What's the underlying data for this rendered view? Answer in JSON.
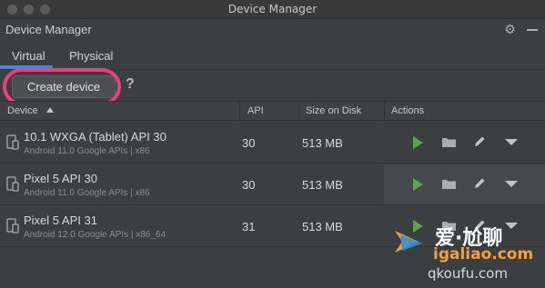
{
  "window": {
    "title": "Device Manager"
  },
  "toolwindow": {
    "title": "Device Manager",
    "settings_icon": "gear-icon",
    "minimize_icon": "minimize-icon"
  },
  "tabs": [
    {
      "label": "Virtual",
      "selected": true
    },
    {
      "label": "Physical",
      "selected": false
    }
  ],
  "actions": {
    "create_label": "Create device",
    "help_label": "?"
  },
  "table": {
    "columns": {
      "device": "Device",
      "api": "API",
      "size": "Size on Disk",
      "actions": "Actions"
    },
    "rows": [
      {
        "name": "10.1  WXGA (Tablet) API 30",
        "sub": "Android 11.0 Google APIs | x86",
        "api": "30",
        "size": "513 MB"
      },
      {
        "name": "Pixel 5 API 30",
        "sub": "Android 11.0 Google APIs | x86",
        "api": "30",
        "size": "513 MB"
      },
      {
        "name": "Pixel 5 API 31",
        "sub": "Android 12.0 Google APIs | x86_64",
        "api": "31",
        "size": "513 MB"
      }
    ]
  },
  "watermark": {
    "line1": "爱·尬聊",
    "line2": "igaliao.com",
    "line3": "qkoufu.com"
  },
  "colors": {
    "accent": "#4a88c7",
    "highlight": "#e9407a",
    "play": "#5fa34a",
    "background": "#3c3f41"
  }
}
